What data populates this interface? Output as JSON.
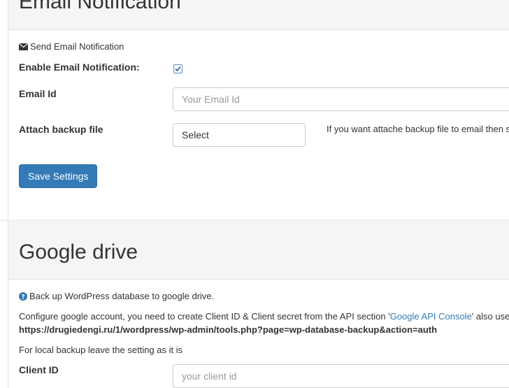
{
  "email_section": {
    "title": "Email Notification",
    "subtitle": "Send Email Notification",
    "enable_label": "Enable Email Notification:",
    "enable_checked": true,
    "email_label": "Email Id",
    "email_placeholder": "Your Email Id",
    "attach_label": "Attach backup file",
    "attach_selected": "Select",
    "attach_help": "If you want attache backup file to email then s",
    "save_label": "Save Settings"
  },
  "drive_section": {
    "title": "Google drive",
    "intro": "Back up WordPress database to google drive.",
    "configure_before": "Configure google account, you need to create Client ID & Client secret from the API section '",
    "configure_link": "Google API Console",
    "configure_after": "' also use",
    "redirect_url": "https://drugiedengi.ru/1/wordpress/wp-admin/tools.php?page=wp-database-backup&action=auth",
    "local_note": "For local backup leave the setting as it is",
    "client_id_label": "Client ID",
    "client_id_placeholder": "your client id"
  },
  "colors": {
    "primary": "#337ab7",
    "link": "#337ab7",
    "panel_heading": "#f5f5f5"
  }
}
